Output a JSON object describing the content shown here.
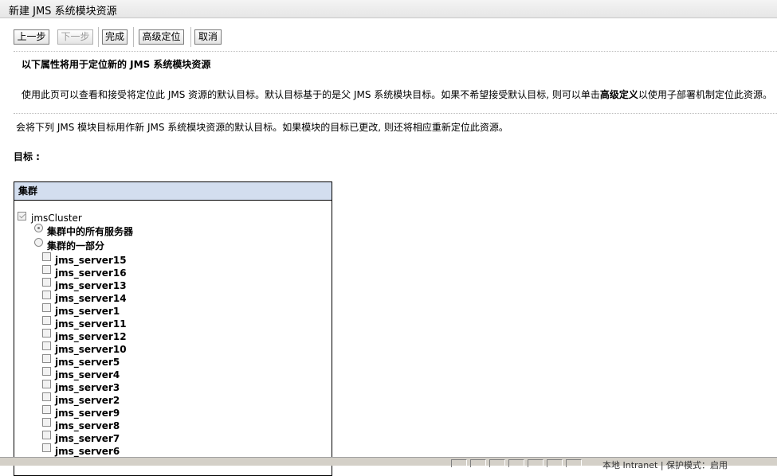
{
  "window": {
    "title": "新建 JMS 系统模块资源"
  },
  "toolbar": {
    "back_label": "上一步",
    "next_label": "下一步",
    "finish_label": "完成",
    "advanced_label": "高级定位",
    "cancel_label": "取消"
  },
  "content": {
    "heading": "以下属性将用于定位新的 JMS 系统模块资源",
    "description_pre": "使用此页可以查看和接受将定位此 JMS 资源的默认目标。默认目标基于的是父 JMS 系统模块目标。如果不希望接受默认目标, 则可以单击",
    "description_link": "高级定义",
    "description_post": "以使用子部署机制定位此资源。",
    "info": "会将下列 JMS 模块目标用作新 JMS 系统模块资源的默认目标。如果模块的目标已更改, 则还将相应重新定位此资源。",
    "targets_label": "目标 :"
  },
  "panel": {
    "header": "集群",
    "cluster": {
      "name": "jmsCluster",
      "checked": true
    },
    "options": [
      {
        "label": "集群中的所有服务器",
        "selected": true
      },
      {
        "label": "集群的一部分",
        "selected": false
      }
    ],
    "servers": [
      "jms_server15",
      "jms_server16",
      "jms_server13",
      "jms_server14",
      "jms_server1",
      "jms_server11",
      "jms_server12",
      "jms_server10",
      "jms_server5",
      "jms_server4",
      "jms_server3",
      "jms_server2",
      "jms_server9",
      "jms_server8",
      "jms_server7",
      "jms_server6"
    ]
  },
  "statusbar": {
    "text": "本地 Intranet | 保护模式：启用"
  }
}
